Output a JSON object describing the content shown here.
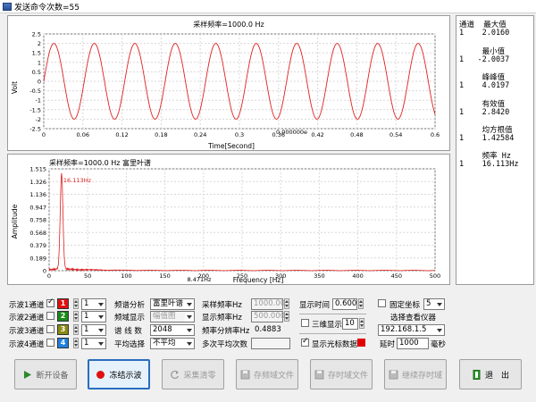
{
  "window": {
    "title": "发送命令次数=55"
  },
  "chart_data": [
    {
      "type": "line",
      "title": "采样频率=1000.0 Hz",
      "xlabel": "Time[Second]",
      "ylabel": "Volt",
      "xlim": [
        0,
        0.6
      ],
      "ylim": [
        -2.5,
        2.5
      ],
      "x_ticks": [
        "0",
        "0.06",
        "0.12",
        "0.18",
        "0.24",
        "0.3",
        "0.36",
        "0.42",
        "0.48",
        "0.54",
        "0.6"
      ],
      "y_ticks": [
        "2.5",
        "2",
        "1.5",
        "1",
        "0.5",
        "0",
        "-0.5",
        "-1",
        "-1.5",
        "-2",
        "-2.5"
      ],
      "annotation": "0.000000e",
      "series": [
        {
          "waveform": "sine",
          "amplitude": 2.0,
          "frequency_hz": 16.113,
          "color": "#e02020"
        }
      ]
    },
    {
      "type": "line",
      "title": "采样频率=1000.0 Hz   富里叶谱",
      "xlabel": "Frequency [Hz]",
      "ylabel": "Amplitude",
      "xlim": [
        0,
        500
      ],
      "ylim": [
        0,
        1.515
      ],
      "x_ticks": [
        "0",
        "50",
        "100",
        "150",
        "200",
        "250",
        "300",
        "350",
        "400",
        "450",
        "500"
      ],
      "y_ticks": [
        "1.515",
        "1.326",
        "1.136",
        "0.947",
        "0.758",
        "0.568",
        "0.379",
        "0.189",
        "0"
      ],
      "peak_label": "16.113Hz",
      "cursor_label": "8.471Hz",
      "series": [
        {
          "peak_freq": 16.113,
          "peak_amp": 1.42,
          "color": "#e02020"
        }
      ]
    }
  ],
  "right_panel": {
    "header": "通道  最大值",
    "rows": [
      {
        "text": "1    2.0160"
      },
      {
        "text": "     最小值"
      },
      {
        "text": "1   -2.0037"
      },
      {
        "text": "     峰峰值"
      },
      {
        "text": "1    4.0197"
      },
      {
        "text": "     有效值"
      },
      {
        "text": "1    2.8420"
      },
      {
        "text": "     均方根值"
      },
      {
        "text": "1    1.42584"
      },
      {
        "text": "     频率 Hz"
      },
      {
        "text": "1    16.113Hz"
      }
    ]
  },
  "channels": [
    {
      "label": "示波1通道",
      "num": "1",
      "color": "#e01010",
      "value": "1",
      "checked": true
    },
    {
      "label": "示波2通道",
      "num": "2",
      "color": "#1a8a1a",
      "value": "1",
      "checked": false
    },
    {
      "label": "示波3通道",
      "num": "3",
      "color": "#8a8a10",
      "value": "1",
      "checked": false
    },
    {
      "label": "示波4通道",
      "num": "4",
      "color": "#2080e0",
      "value": "1",
      "checked": false
    }
  ],
  "analysis": {
    "spectrum_label": "频谱分析",
    "spectrum_value": "富里叶谱",
    "freq_display_label": "频域显示",
    "freq_display_value": "幅值图",
    "lines_label": "谱 线 数",
    "lines_value": "2048",
    "avg_label": "平均选择",
    "avg_value": "不平均"
  },
  "sampling": {
    "rate_label": "采样频率Hz",
    "rate_value": "1000.000",
    "display_rate_label": "显示频率Hz",
    "display_rate_value": "500.000",
    "resolution_label": "频率分辨率Hz",
    "resolution_value": "0.4883",
    "avg_count_label": "多次平均次数"
  },
  "display": {
    "time_label": "显示时间",
    "time_value": "0.600",
    "three_d_label": "三维显示",
    "three_d_value": "10",
    "cursor_label": "显示光标数据"
  },
  "instrument": {
    "fixed_axis_label": "固定坐标",
    "fixed_axis_value": "5",
    "select_label": "选择查看仪器",
    "ip_value": "192.168.1.5",
    "delay_label": "延时",
    "delay_value": "1000",
    "delay_unit": "毫秒"
  },
  "buttons": {
    "disconnect": "断开设备",
    "freeze": "冻结示波",
    "collect_clear": "采集清零",
    "save_freq": "存频域文件",
    "save_time": "存时域文件",
    "continue_save": "继续存时域",
    "exit": "退　出"
  }
}
